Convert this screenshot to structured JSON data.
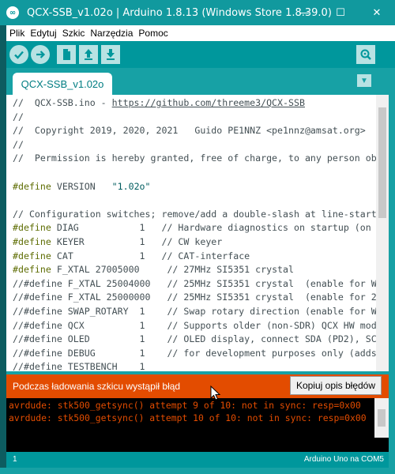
{
  "window": {
    "title": "QCX-SSB_v1.02o | Arduino 1.8.13 (Windows Store 1.8.39.0)",
    "minimize": "—",
    "maximize": "☐",
    "close": "✕"
  },
  "menu": [
    "Plik",
    "Edytuj",
    "Szkic",
    "Narzędzia",
    "Pomoc"
  ],
  "toolbar": {
    "buttons": [
      "verify-icon",
      "upload-icon",
      "new-icon",
      "open-icon",
      "save-icon"
    ],
    "serial_monitor": "serial-monitor-icon"
  },
  "tab": {
    "name": "QCX-SSB_v1.02o",
    "menu_icon": "tab-menu-icon"
  },
  "editor": {
    "lines": [
      "//  QCX-SSB.ino - https://github.com/threeme3/QCX-SSB",
      "//",
      "//  Copyright 2019, 2020, 2021   Guido PE1NNZ <pe1nnz@amsat.org>",
      "//",
      "//  Permission is hereby granted, free of charge, to any person ob",
      "",
      "#define VERSION   \"1.02o\"",
      "",
      "// Configuration switches; remove/add a double-slash at line-start",
      "#define DIAG           1   // Hardware diagnostics on startup (on",
      "#define KEYER          1   // CW keyer",
      "#define CAT            1   // CAT-interface",
      "#define F_XTAL 27005000     // 27MHz SI5351 crystal",
      "//#define F_XTAL 25004000   // 25MHz SI5351 crystal  (enable for W",
      "//#define F_XTAL 25000000   // 25MHz SI5351 crystal  (enable for 2",
      "//#define SWAP_ROTARY  1    // Swap rotary direction (enable for W",
      "//#define QCX          1    // Supports older (non-SDR) QCX HW mod",
      "//#define OLED         1    // OLED display, connect SDA (PD2), SC",
      "//#define DEBUG        1    // for development purposes only (adds",
      "//#define TESTBENCH    1"
    ]
  },
  "error": {
    "message": "Podczas ładowania szkicu wystąpił błąd",
    "copy_button": "Kopiuj opis błędów"
  },
  "console": {
    "lines": [
      "avrdude: stk500_getsync() attempt 9 of 10: not in sync: resp=0x00",
      "avrdude: stk500_getsync() attempt 10 of 10: not in sync: resp=0x00"
    ]
  },
  "status": {
    "line": "1",
    "board": "Arduino Uno na COM5"
  },
  "colors": {
    "teal": "#00979c",
    "teal_light": "#17a1a5",
    "error_orange": "#e34c00",
    "keyword_green": "#5e6d03",
    "string_teal": "#005c5f"
  }
}
